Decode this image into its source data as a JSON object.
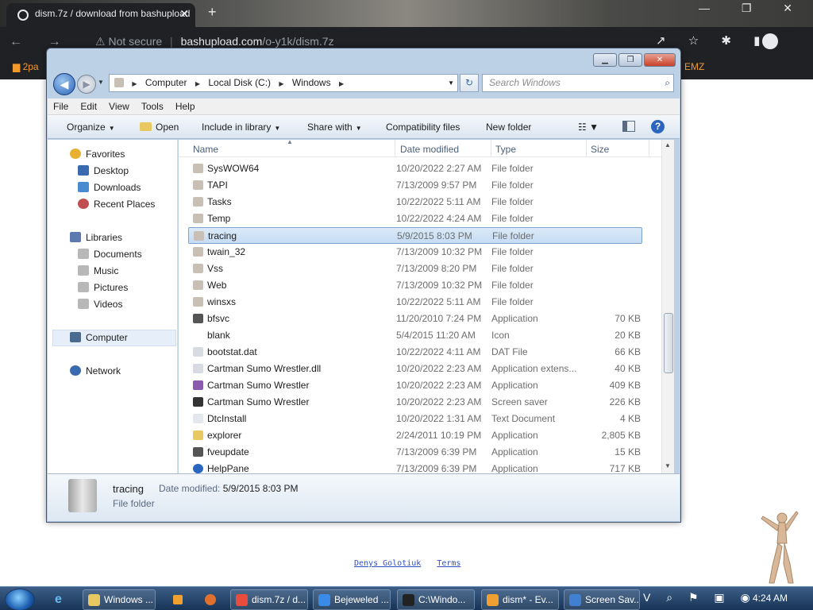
{
  "browser": {
    "tab_title": "dism.7z / download from bashupload",
    "tab_close": "✕",
    "new_tab": "+",
    "window_controls": "— ❐ ✕",
    "nav_icons": "← → ↻",
    "security": "Not secure",
    "url_host": "bashupload.com",
    "url_path": "/o-y1k/dism.7z",
    "toolbar_icons": "↗ ☆ ✱ ▮",
    "bookmark_left": "2pa",
    "bookmark_right": "EMZ"
  },
  "page": {
    "footer_link_1": "Denys Golotiuk",
    "footer_link_2": "Terms"
  },
  "explorer": {
    "title_buttons": {
      "minimize": "▁",
      "maximize": "❐",
      "close": "✕"
    },
    "nav": {
      "back": "◀",
      "forward": "▶",
      "dropdown": "▼"
    },
    "breadcrumb": [
      "Computer",
      "Local Disk (C:)",
      "Windows"
    ],
    "breadcrumb_sep": "▶",
    "addr_dropdown": "▼",
    "refresh": "↻",
    "search_placeholder": "Search Windows",
    "search_icon": "⌕",
    "menu": [
      "File",
      "Edit",
      "View",
      "Tools",
      "Help"
    ],
    "commands": {
      "organize": "Organize",
      "open": "Open",
      "include": "Include in library",
      "share": "Share with",
      "compat": "Compatibility files",
      "new_folder": "New folder",
      "dd": "▼",
      "view": "☷ ▼",
      "help": "?"
    },
    "nav_pane": {
      "favorites": "Favorites",
      "desktop": "Desktop",
      "downloads": "Downloads",
      "recent": "Recent Places",
      "libraries": "Libraries",
      "documents": "Documents",
      "music": "Music",
      "pictures": "Pictures",
      "videos": "Videos",
      "computer": "Computer",
      "network": "Network"
    },
    "columns": {
      "name": "Name",
      "date": "Date modified",
      "type": "Type",
      "size": "Size",
      "sort": "▲"
    },
    "files": [
      {
        "name": "SysWOW64",
        "date": "10/20/2022 2:27 AM",
        "type": "File folder",
        "size": "",
        "icon": "folder"
      },
      {
        "name": "TAPI",
        "date": "7/13/2009 9:57 PM",
        "type": "File folder",
        "size": "",
        "icon": "folder"
      },
      {
        "name": "Tasks",
        "date": "10/22/2022 5:11 AM",
        "type": "File folder",
        "size": "",
        "icon": "folder"
      },
      {
        "name": "Temp",
        "date": "10/22/2022 4:24 AM",
        "type": "File folder",
        "size": "",
        "icon": "folder"
      },
      {
        "name": "tracing",
        "date": "5/9/2015 8:03 PM",
        "type": "File folder",
        "size": "",
        "icon": "folder",
        "selected": true
      },
      {
        "name": "twain_32",
        "date": "7/13/2009 10:32 PM",
        "type": "File folder",
        "size": "",
        "icon": "folder"
      },
      {
        "name": "Vss",
        "date": "7/13/2009 8:20 PM",
        "type": "File folder",
        "size": "",
        "icon": "folder"
      },
      {
        "name": "Web",
        "date": "7/13/2009 10:32 PM",
        "type": "File folder",
        "size": "",
        "icon": "folder"
      },
      {
        "name": "winsxs",
        "date": "10/22/2022 5:11 AM",
        "type": "File folder",
        "size": "",
        "icon": "folder"
      },
      {
        "name": "bfsvc",
        "date": "11/20/2010 7:24 PM",
        "type": "Application",
        "size": "70 KB",
        "icon": "app"
      },
      {
        "name": "blank",
        "date": "5/4/2015 11:20 AM",
        "type": "Icon",
        "size": "20 KB",
        "icon": "blank"
      },
      {
        "name": "bootstat.dat",
        "date": "10/22/2022 4:11 AM",
        "type": "DAT File",
        "size": "66 KB",
        "icon": "file"
      },
      {
        "name": "Cartman Sumo Wrestler.dll",
        "date": "10/20/2022 2:23 AM",
        "type": "Application extens...",
        "size": "40 KB",
        "icon": "file"
      },
      {
        "name": "Cartman Sumo Wrestler",
        "date": "10/20/2022 2:23 AM",
        "type": "Application",
        "size": "409 KB",
        "icon": "gear"
      },
      {
        "name": "Cartman Sumo Wrestler",
        "date": "10/20/2022 2:23 AM",
        "type": "Screen saver",
        "size": "226 KB",
        "icon": "screensaver"
      },
      {
        "name": "DtcInstall",
        "date": "10/20/2022 1:31 AM",
        "type": "Text Document",
        "size": "4 KB",
        "icon": "text"
      },
      {
        "name": "explorer",
        "date": "2/24/2011 10:19 PM",
        "type": "Application",
        "size": "2,805 KB",
        "icon": "folder-app"
      },
      {
        "name": "fveupdate",
        "date": "7/13/2009 6:39 PM",
        "type": "Application",
        "size": "15 KB",
        "icon": "app"
      },
      {
        "name": "HelpPane",
        "date": "7/13/2009 6:39 PM",
        "type": "Application",
        "size": "717 KB",
        "icon": "help"
      }
    ],
    "scroll": {
      "up": "▲",
      "down": "▼"
    },
    "details": {
      "name": "tracing",
      "date_label": "Date modified:",
      "date_value": "5/9/2015 8:03 PM",
      "type": "File folder"
    }
  },
  "taskbar": {
    "items": [
      {
        "label": "Windows ...",
        "color": "#e8c860"
      },
      {
        "label": "dism.7z / d...",
        "color": "#e84c3c"
      },
      {
        "label": "Bejeweled ...",
        "color": "#3a8ae8"
      },
      {
        "label": "C:\\Windo...",
        "color": "#222222"
      },
      {
        "label": "dism* - Ev...",
        "color": "#f0a030"
      },
      {
        "label": "Screen Sav...",
        "color": "#4080d0"
      }
    ],
    "tray_icons": "V ⌕ ⚑ ▣ ◉",
    "clock": "4:24 AM"
  },
  "colors": {
    "folder": "#c8c0b4",
    "selection": "#c4dcf4",
    "accent": "#2a66c0",
    "chrome_dark": "#202124",
    "bookmark_orange": "#f29a2e"
  }
}
